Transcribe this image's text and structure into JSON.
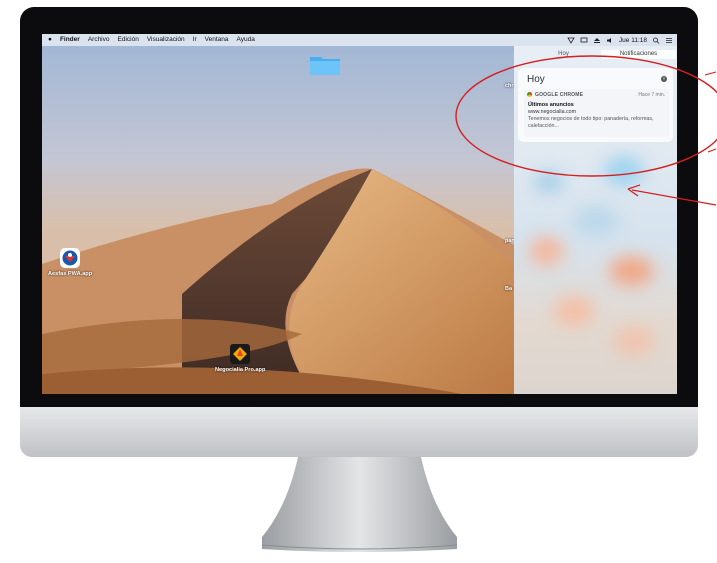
{
  "menubar": {
    "apple": "",
    "items": [
      "Finder",
      "Archivo",
      "Edición",
      "Visualización",
      "Ir",
      "Ventana",
      "Ayuda"
    ],
    "clock": "Jue 11:18"
  },
  "desktop": {
    "icons": [
      {
        "label": "Aesfas PWA.app",
        "icon": "aesfas-app-icon"
      },
      {
        "label": "Negocialia Pro.app",
        "icon": "negocialia-app-icon"
      }
    ],
    "edge_labels": [
      "chr",
      "pan",
      "Ba"
    ]
  },
  "notification_center": {
    "tabs": [
      "Hoy",
      "Notificaciones"
    ],
    "section_title": "Hoy",
    "notification": {
      "app": "GOOGLE CHROME",
      "time": "Hace 7 min.",
      "title": "Últimos anuncios",
      "url": "www.negocialia.com",
      "body": "Tenemos negocios de todo tipo: panadería, reformas, calefacción..."
    }
  },
  "colors": {
    "annotation": "#d32020",
    "bezel": "#0c0c0e",
    "panel": "#e8eef5"
  }
}
